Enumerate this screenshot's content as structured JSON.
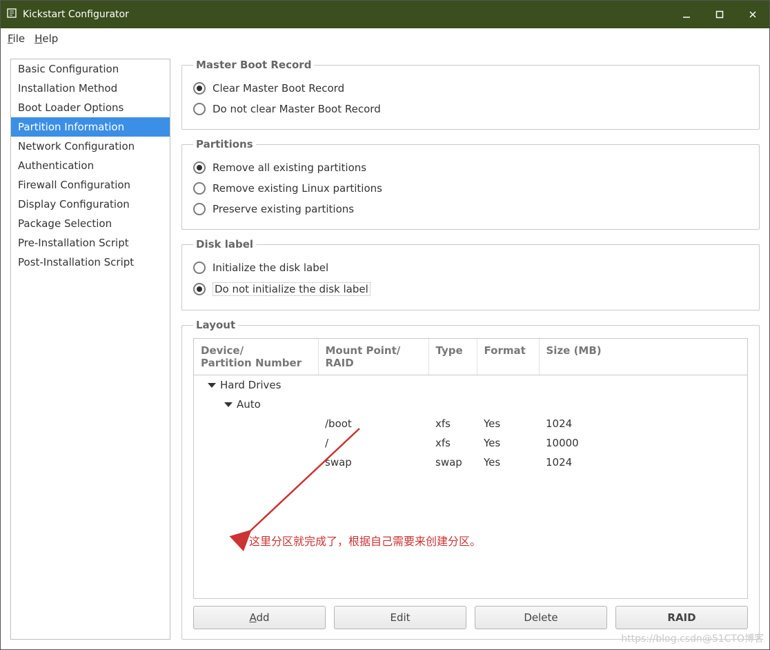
{
  "window": {
    "title": "Kickstart Configurator"
  },
  "menubar": {
    "file": "File",
    "help": "Help"
  },
  "sidebar": {
    "items": [
      {
        "label": "Basic Configuration"
      },
      {
        "label": "Installation Method"
      },
      {
        "label": "Boot Loader Options"
      },
      {
        "label": "Partition Information",
        "selected": true
      },
      {
        "label": "Network Configuration"
      },
      {
        "label": "Authentication"
      },
      {
        "label": "Firewall Configuration"
      },
      {
        "label": "Display Configuration"
      },
      {
        "label": "Package Selection"
      },
      {
        "label": "Pre-Installation Script"
      },
      {
        "label": "Post-Installation Script"
      }
    ]
  },
  "groups": {
    "mbr": {
      "legend": "Master Boot Record",
      "options": {
        "clear": "Clear Master Boot Record",
        "keep": "Do not clear Master Boot Record"
      },
      "selected": "clear"
    },
    "partitions": {
      "legend": "Partitions",
      "options": {
        "remove_all": "Remove all existing partitions",
        "remove_linux": "Remove existing Linux partitions",
        "preserve": "Preserve existing partitions"
      },
      "selected": "remove_all"
    },
    "disklabel": {
      "legend": "Disk label",
      "options": {
        "init": "Initialize the disk label",
        "noinit": "Do not initialize the disk label"
      },
      "selected": "noinit"
    },
    "layout": {
      "legend": "Layout",
      "headers": {
        "device": "Device/\nPartition Number",
        "mount": "Mount Point/\nRAID",
        "type": "Type",
        "format": "Format",
        "size": "Size (MB)"
      },
      "tree": {
        "root_label": "Hard Drives",
        "auto_label": "Auto",
        "rows": [
          {
            "mount": "/boot",
            "type": "xfs",
            "format": "Yes",
            "size": "1024"
          },
          {
            "mount": "/",
            "type": "xfs",
            "format": "Yes",
            "size": "10000"
          },
          {
            "mount": "swap",
            "type": "swap",
            "format": "Yes",
            "size": "1024"
          }
        ]
      },
      "buttons": {
        "add": "Add",
        "edit": "Edit",
        "delete": "Delete",
        "raid": "RAID"
      }
    }
  },
  "annotation": {
    "text": "这里分区就完成了，根据自己需要来创建分区。"
  },
  "watermark": "https://blog.csdn@51CTO博客",
  "colors": {
    "titlebar": "#3a4e1e",
    "selection": "#3b8fe6",
    "annotation": "#cc3333"
  }
}
